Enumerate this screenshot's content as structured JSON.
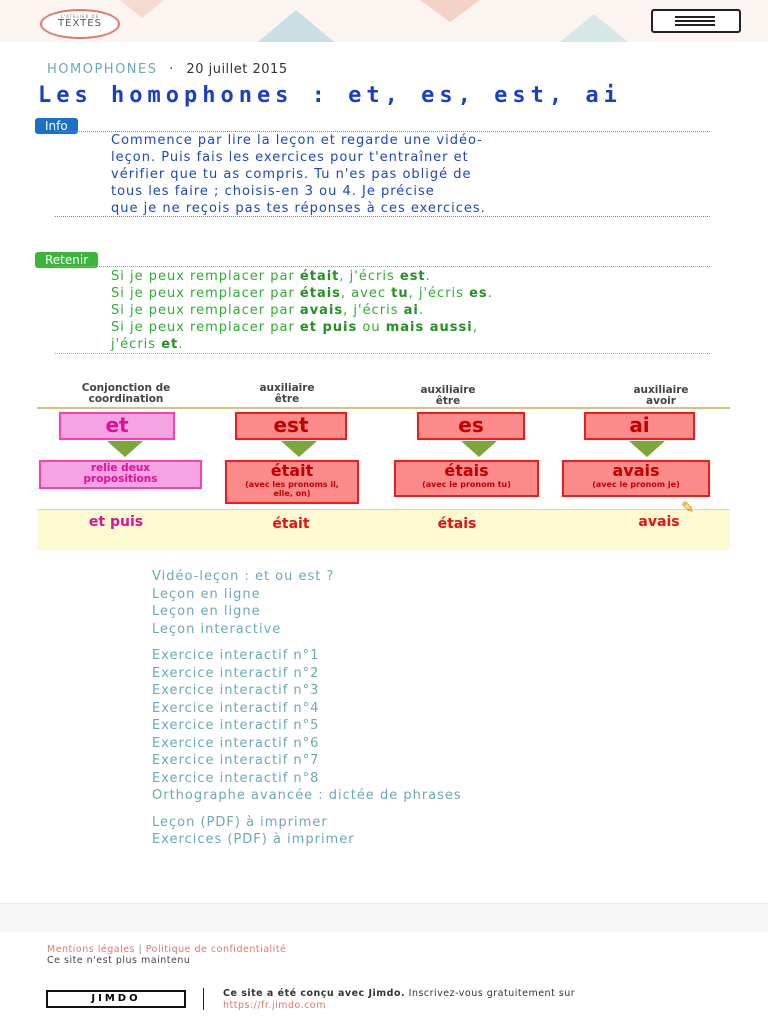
{
  "header": {
    "logo_small": "L'ATELIER DE",
    "logo_big": "TEXTES",
    "menu_icon": "hamburger-icon"
  },
  "post": {
    "category": "HOMOPHONES",
    "separator": "·",
    "date": "20 juillet 2015",
    "title": "Les homophones : et, es, est, ai"
  },
  "info": {
    "label": "Info",
    "lines": [
      "Commence par lire la leçon et regarde une vidéo-",
      "leçon. Puis fais les exercices pour t'entraîner et",
      "vérifier que tu as compris. Tu n'es pas obligé de",
      "tous les faire ; choisis-en 3 ou 4. Je précise",
      "que je ne reçois pas tes réponses à ces exercices."
    ]
  },
  "retenir": {
    "label": "Retenir",
    "l1a": "Si je peux remplacer par ",
    "l1b": "était",
    "l1c": ", j'écris ",
    "l1d": "est",
    "l1e": ".",
    "l2a": "Si je peux remplacer par ",
    "l2b": "étais",
    "l2c": ", avec ",
    "l2d": "tu",
    "l2e": ", j'écris ",
    "l2f": "es",
    "l2g": ".",
    "l3a": "Si je peux remplacer par ",
    "l3b": "avais",
    "l3c": ", j'écris ",
    "l3d": "ai",
    "l3e": ".",
    "l4a": "Si je peux remplacer par ",
    "l4b": "et puis",
    "l4c": " ou ",
    "l4d": "mais aussi",
    "l4e": ",",
    "l5a": "j'écris ",
    "l5b": "et",
    "l5c": "."
  },
  "diagram": {
    "heads": [
      {
        "l1": "Conjonction de",
        "l2": "coordination"
      },
      {
        "l1": "auxiliaire",
        "l2": "être"
      },
      {
        "l1": "auxiliaire",
        "l2": "être"
      },
      {
        "l1": "auxiliaire",
        "l2": "avoir"
      }
    ],
    "words": [
      "et",
      "est",
      "es",
      "ai"
    ],
    "defs": [
      {
        "main": "relie deux propositions",
        "sub": ""
      },
      {
        "main": "était",
        "sub": "(avec les pronoms il, elle, on)"
      },
      {
        "main": "étais",
        "sub": "(avec le pronom tu)"
      },
      {
        "main": "avais",
        "sub": "(avec le pronom je)"
      }
    ],
    "band": [
      "et puis",
      "était",
      "étais",
      "avais"
    ],
    "colors": {
      "pink": "#ff3fb0",
      "pink_fill": "#f6a3e4",
      "red": "#f01c1c",
      "red_fill": "#fb8a8a",
      "green_arrow": "#7da63a"
    }
  },
  "links": {
    "group1": [
      "Vidéo-leçon : et ou est ?",
      "Leçon en ligne",
      "Leçon en ligne",
      "Leçon interactive"
    ],
    "group2": [
      "Exercice interactif n°1",
      "Exercice interactif n°2",
      "Exercice interactif n°3",
      "Exercice interactif n°4",
      "Exercice interactif n°5",
      "Exercice interactif n°6",
      "Exercice interactif n°7",
      "Exercice interactif n°8",
      "Orthographe avancée : dictée de phrases"
    ],
    "group3": [
      "Leçon (PDF) à imprimer",
      "Exercices (PDF) à imprimer"
    ]
  },
  "footer": {
    "mentions": "Mentions légales",
    "sep": "|",
    "privacy": "Politique de confidentialité",
    "notmaint": "Ce site n'est plus maintenu",
    "jimdo": "JIMDO",
    "made_bold": "Ce site a été conçu avec Jimdo.",
    "made_rest": " Inscrivez-vous gratuitement sur",
    "url": "https://fr.jimdo.com"
  }
}
